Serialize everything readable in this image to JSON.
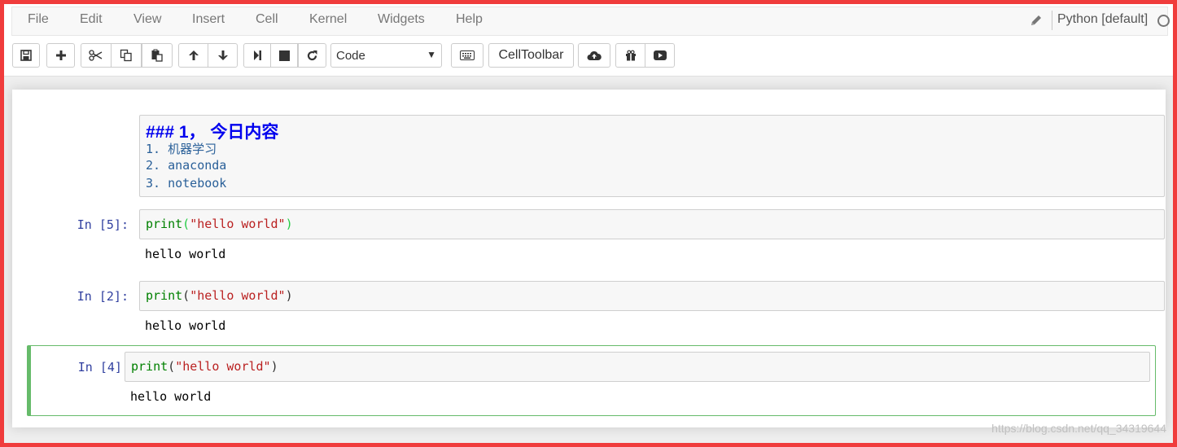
{
  "menu": {
    "items": [
      "File",
      "Edit",
      "View",
      "Insert",
      "Cell",
      "Kernel",
      "Widgets",
      "Help"
    ],
    "kernel_name": "Python [default]"
  },
  "toolbar": {
    "cell_type": "Code",
    "celltoolbar_label": "CellToolbar",
    "icons": [
      "save-icon",
      "plus-icon",
      "scissors-icon",
      "copy-icon",
      "paste-icon",
      "arrow-up-icon",
      "arrow-down-icon",
      "step-forward-icon",
      "stop-icon",
      "restart-icon",
      "keyboard-icon",
      "cloud-upload-icon",
      "gift-icon",
      "play-icon"
    ]
  },
  "cells": {
    "markdown": {
      "heading": "### 1， 今日内容",
      "lines": [
        "1. 机器学习",
        "2. anaconda",
        "3. notebook"
      ]
    },
    "code": [
      {
        "prompt": "In  [5]:",
        "fn": "print",
        "open": "(",
        "str": "\"hello world\"",
        "close": ")",
        "output": "hello world"
      },
      {
        "prompt": "In  [2]:",
        "fn": "print",
        "open": "(",
        "str": "\"hello world\"",
        "close": ")",
        "output": "hello world"
      },
      {
        "prompt": "In  [4]:",
        "fn": "print",
        "open": "(",
        "str": "\"hello world\"",
        "close": ")",
        "output": "hello world"
      }
    ]
  },
  "watermark": "https://blog.csdn.net/qq_34319644",
  "colors": {
    "frame": "#f03c3c",
    "selected_cell": "#66bb6a",
    "prompt": "#303f9f",
    "keyword": "#008000",
    "string": "#ba2121"
  }
}
